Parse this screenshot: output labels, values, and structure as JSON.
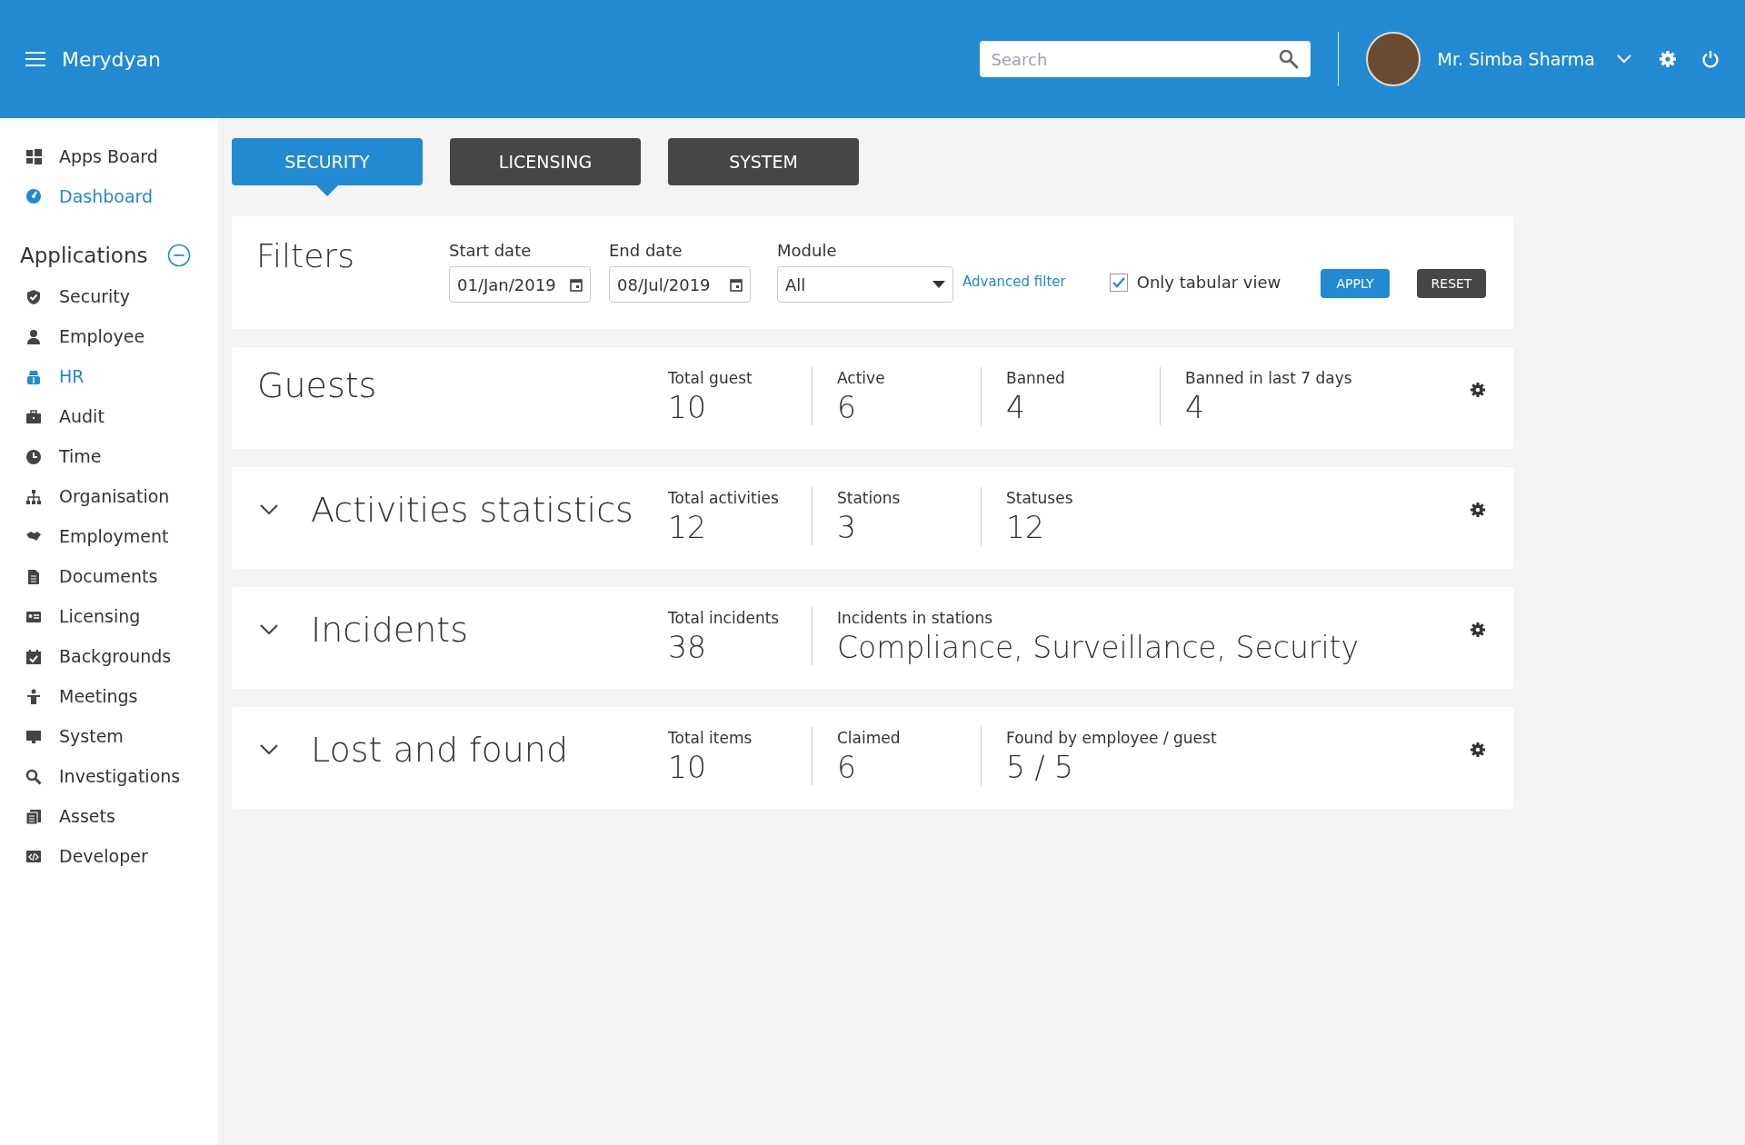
{
  "header": {
    "app_name": "Merydyan",
    "search": {
      "placeholder": "Search"
    },
    "user_name": "Mr. Simba Sharma"
  },
  "sidebar": {
    "top_items": [
      {
        "label": "Apps Board",
        "highlighted": false
      },
      {
        "label": "Dashboard",
        "highlighted": true
      }
    ],
    "section_title": "Applications",
    "items": [
      {
        "label": "Security",
        "highlighted": false
      },
      {
        "label": "Employee",
        "highlighted": false
      },
      {
        "label": "HR",
        "highlighted": true
      },
      {
        "label": "Audit",
        "highlighted": false
      },
      {
        "label": "Time",
        "highlighted": false
      },
      {
        "label": "Organisation",
        "highlighted": false
      },
      {
        "label": "Employment",
        "highlighted": false
      },
      {
        "label": "Documents",
        "highlighted": false
      },
      {
        "label": "Licensing",
        "highlighted": false
      },
      {
        "label": "Backgrounds",
        "highlighted": false
      },
      {
        "label": "Meetings",
        "highlighted": false
      },
      {
        "label": "System",
        "highlighted": false
      },
      {
        "label": "Investigations",
        "highlighted": false
      },
      {
        "label": "Assets",
        "highlighted": false
      },
      {
        "label": "Developer",
        "highlighted": false
      }
    ]
  },
  "tabs": [
    {
      "label": "SECURITY",
      "selected": true
    },
    {
      "label": "LICENSING",
      "selected": false
    },
    {
      "label": "SYSTEM",
      "selected": false
    }
  ],
  "filters": {
    "title": "Filters",
    "start_date": {
      "label": "Start date",
      "value": "01/Jan/2019"
    },
    "end_date": {
      "label": "End date",
      "value": "08/Jul/2019"
    },
    "module": {
      "label": "Module",
      "value": "All"
    },
    "advanced_link": "Advanced filter",
    "tabular": {
      "label": "Only tabular view",
      "checked": true
    },
    "apply": "APPLY",
    "reset": "RESET"
  },
  "cards": [
    {
      "title": "Guests",
      "collapsible": false,
      "stats": [
        {
          "label": "Total guest",
          "value": "10"
        },
        {
          "label": "Active",
          "value": "6"
        },
        {
          "label": "Banned",
          "value": "4"
        },
        {
          "label": "Banned in last 7 days",
          "value": "4"
        }
      ]
    },
    {
      "title": "Activities statistics",
      "collapsible": true,
      "stats": [
        {
          "label": "Total activities",
          "value": "12"
        },
        {
          "label": "Stations",
          "value": "3"
        },
        {
          "label": "Statuses",
          "value": "12"
        }
      ]
    },
    {
      "title": "Incidents",
      "collapsible": true,
      "stats": [
        {
          "label": "Total incidents",
          "value": "38"
        },
        {
          "label": "Incidents in stations",
          "value": "Compliance, Surveillance, Security"
        }
      ]
    },
    {
      "title": "Lost and found",
      "collapsible": true,
      "stats": [
        {
          "label": "Total items",
          "value": "10"
        },
        {
          "label": "Claimed",
          "value": "6"
        },
        {
          "label": "Found by employee / guest",
          "value": "5 / 5"
        }
      ]
    }
  ]
}
